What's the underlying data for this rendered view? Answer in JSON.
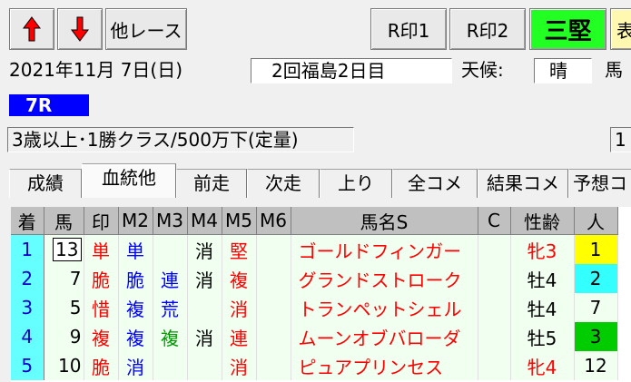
{
  "toolbar": {
    "other_races": "他レース",
    "r_mark1": "R印1",
    "r_mark2": "R印2",
    "sanken": "三堅",
    "cut": "表"
  },
  "race_info": {
    "date": "2021年11月 7日(日)",
    "meeting": "2回福島2日目",
    "weather_label": "天候:",
    "weather": "晴",
    "track_label": "馬",
    "race_no": "7R",
    "conditions": "3歳以上･1勝クラス/500万下(定量)",
    "right_value": "1"
  },
  "tabs": [
    "成績",
    "血統他",
    "前走",
    "次走",
    "上り",
    "全コメ",
    "結果コメ",
    "予想コ"
  ],
  "columns": [
    "着",
    "馬",
    "印",
    "M2",
    "M3",
    "M4",
    "M5",
    "M6",
    "馬名S",
    "C",
    "性齢",
    "人"
  ],
  "rows": [
    {
      "rank": "1",
      "num": "13",
      "in": "単",
      "m2": "単",
      "m3": "",
      "m4": "消",
      "m5": "堅",
      "m6": "",
      "name": "ゴールドフィンガー",
      "c": "",
      "sex": "牝3",
      "pop": "1"
    },
    {
      "rank": "2",
      "num": "7",
      "in": "脆",
      "m2": "脆",
      "m3": "連",
      "m4": "消",
      "m5": "複",
      "m6": "",
      "name": "グランドストローク",
      "c": "",
      "sex": "牡4",
      "pop": "2"
    },
    {
      "rank": "3",
      "num": "5",
      "in": "惜",
      "m2": "複",
      "m3": "荒",
      "m4": "",
      "m5": "消",
      "m6": "",
      "name": "トランペットシェル",
      "c": "",
      "sex": "牡4",
      "pop": "7"
    },
    {
      "rank": "4",
      "num": "9",
      "in": "複",
      "m2": "複",
      "m3": "複",
      "m4": "消",
      "m5": "連",
      "m6": "",
      "name": "ムーンオブバローダ",
      "c": "",
      "sex": "牡5",
      "pop": "3"
    },
    {
      "rank": "5",
      "num": "10",
      "in": "脆",
      "m2": "消",
      "m3": "",
      "m4": "",
      "m5": "消",
      "m6": "",
      "name": "ピュアプリンセス",
      "c": "",
      "sex": "牝4",
      "pop": "12"
    }
  ],
  "colors": {
    "up_arrow": "#ff0000",
    "down_arrow": "#ff0000",
    "rank_bg": "#66ffff",
    "pop1": "#ffff00",
    "pop2": "#33ffff",
    "pop3": "#00cc00",
    "race_badge": "#0000ff",
    "sanken_bg": "#22ff22"
  }
}
